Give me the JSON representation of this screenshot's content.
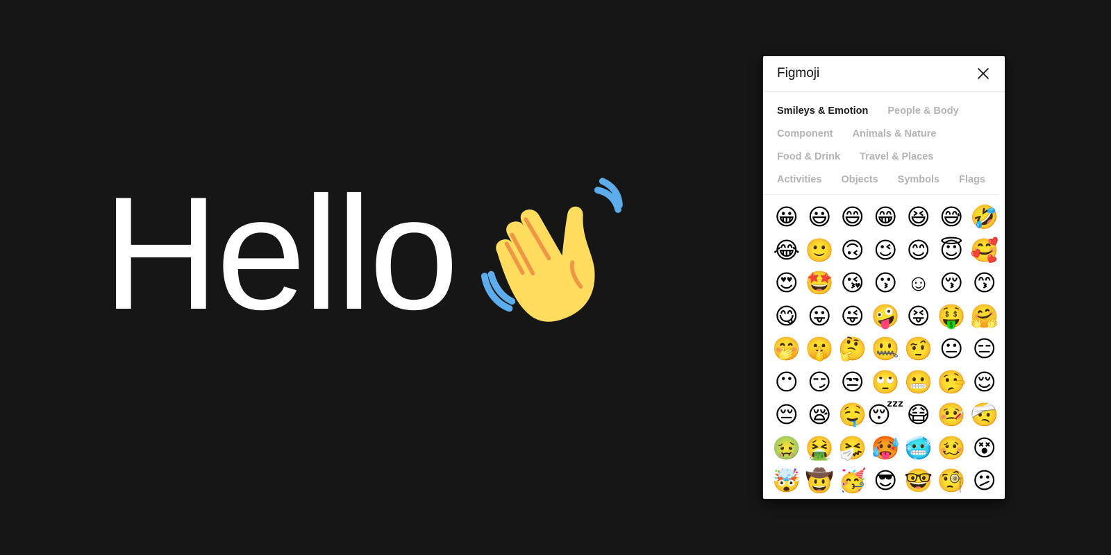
{
  "hero": {
    "text": "Hello",
    "emoji": "waving-hand"
  },
  "panel": {
    "title": "Figmoji",
    "close_icon": "close-icon",
    "categories": [
      {
        "label": "Smileys & Emotion",
        "active": true
      },
      {
        "label": "People & Body",
        "active": false
      },
      {
        "label": "Component",
        "active": false
      },
      {
        "label": "Animals & Nature",
        "active": false
      },
      {
        "label": "Food & Drink",
        "active": false
      },
      {
        "label": "Travel & Places",
        "active": false
      },
      {
        "label": "Activities",
        "active": false
      },
      {
        "label": "Objects",
        "active": false
      },
      {
        "label": "Symbols",
        "active": false
      },
      {
        "label": "Flags",
        "active": false
      }
    ],
    "emojis": [
      [
        "grinning-face",
        "grinning-face-with-big-eyes",
        "grinning-face-with-smiling-eyes",
        "beaming-face-with-smiling-eyes",
        "grinning-squinting-face",
        "grinning-face-with-sweat",
        "rolling-on-the-floor-laughing"
      ],
      [
        "face-with-tears-of-joy",
        "slightly-smiling-face",
        "upside-down-face",
        "winking-face",
        "smiling-face-with-smiling-eyes",
        "smiling-face-with-halo",
        "smiling-face-with-hearts"
      ],
      [
        "smiling-face-with-heart-eyes",
        "star-struck",
        "face-blowing-a-kiss",
        "kissing-face",
        "smiling-face",
        "kissing-face-with-closed-eyes",
        "kissing-face-with-smiling-eyes"
      ],
      [
        "face-savoring-food",
        "face-with-tongue",
        "winking-face-with-tongue",
        "zany-face",
        "squinting-face-with-tongue",
        "money-mouth-face",
        "hugging-face"
      ],
      [
        "face-with-hand-over-mouth",
        "shushing-face",
        "thinking-face",
        "zipper-mouth-face",
        "face-with-raised-eyebrow",
        "neutral-face",
        "expressionless-face"
      ],
      [
        "face-without-mouth",
        "smirking-face",
        "unamused-face",
        "face-with-rolling-eyes",
        "grimacing-face",
        "lying-face",
        "relieved-face"
      ],
      [
        "pensive-face",
        "sleepy-face",
        "drooling-face",
        "sleeping-face",
        "face-with-medical-mask",
        "face-with-thermometer",
        "face-with-head-bandage"
      ],
      [
        "nauseated-face",
        "face-vomiting",
        "sneezing-face",
        "hot-face",
        "cold-face",
        "woozy-face",
        "knocked-out-face"
      ],
      [
        "exploding-head",
        "cowboy-hat-face",
        "partying-face",
        "smiling-face-with-sunglasses",
        "nerd-face",
        "face-with-monocle",
        "confused-face"
      ]
    ],
    "emoji_glyphs": [
      [
        "😀",
        "😃",
        "😄",
        "😁",
        "😆",
        "😅",
        "🤣"
      ],
      [
        "😂",
        "🙂",
        "🙃",
        "😉",
        "😊",
        "😇",
        "🥰"
      ],
      [
        "😍",
        "🤩",
        "😘",
        "😗",
        "☺",
        "😚",
        "😙"
      ],
      [
        "😋",
        "😛",
        "😜",
        "🤪",
        "😝",
        "🤑",
        "🤗"
      ],
      [
        "🤭",
        "🤫",
        "🤔",
        "🤐",
        "🤨",
        "😐",
        "😑"
      ],
      [
        "😶",
        "😏",
        "😒",
        "🙄",
        "😬",
        "🤥",
        "😌"
      ],
      [
        "😔",
        "😪",
        "🤤",
        "😴",
        "😷",
        "🤒",
        "🤕"
      ],
      [
        "🤢",
        "🤮",
        "🤧",
        "🥵",
        "🥶",
        "🥴",
        "😵"
      ],
      [
        "🤯",
        "🤠",
        "🥳",
        "😎",
        "🤓",
        "🧐",
        "😕"
      ]
    ]
  }
}
